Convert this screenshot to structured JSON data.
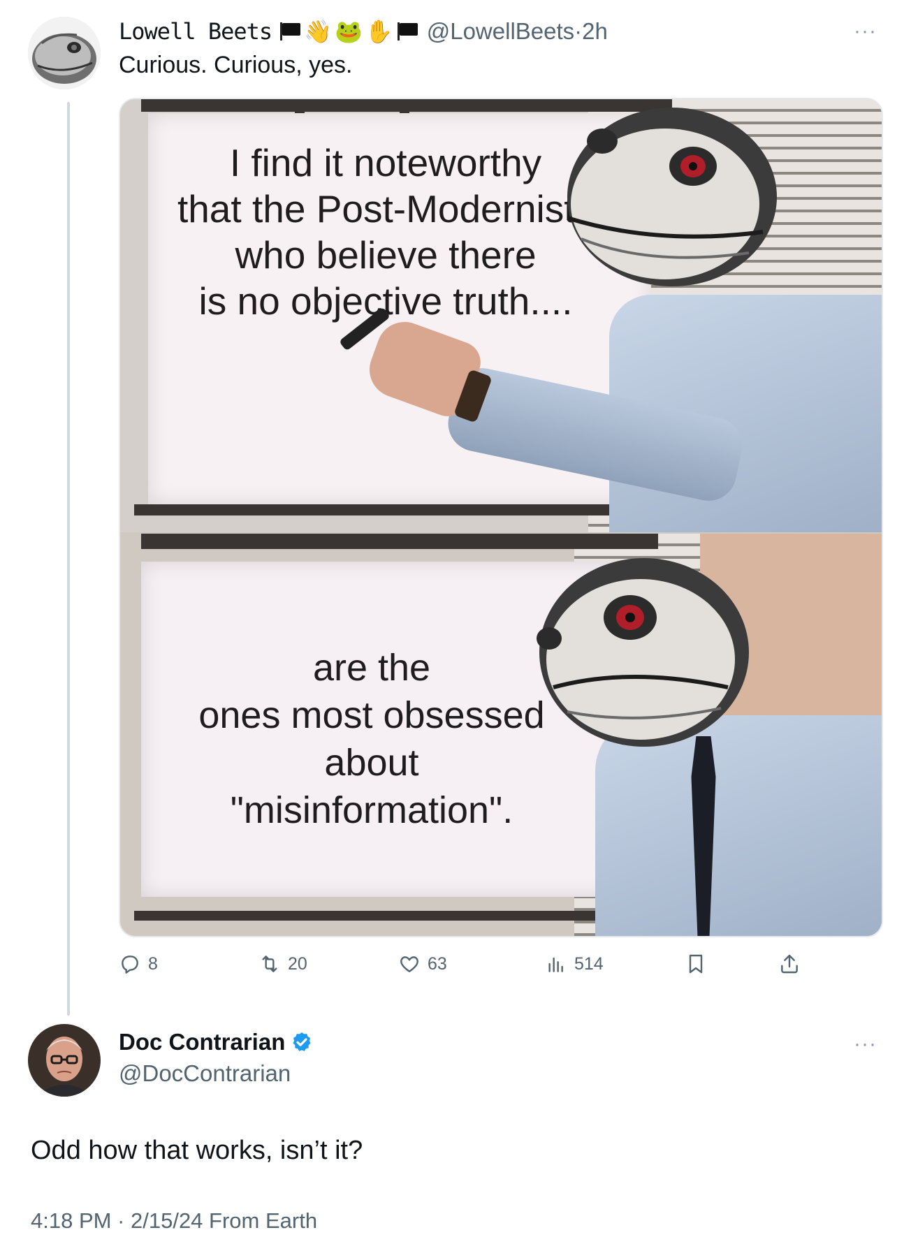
{
  "tweet": {
    "author_name": "Lowell Beets",
    "name_emojis": [
      "black-flag",
      "waving-hand",
      "frog",
      "raised-hand",
      "black-flag"
    ],
    "handle": "@LowellBeets",
    "separator": "·",
    "time_ago": "2h",
    "text": "Curious. Curious, yes.",
    "more_label": "···",
    "media": {
      "top_panel_text": [
        "I find it noteworthy",
        "that the Post-Modernists",
        "who believe there",
        "is no objective truth...."
      ],
      "bottom_panel_text": [
        "are the",
        "ones most obsessed",
        "about",
        "\"misinformation\"."
      ]
    },
    "actions": {
      "replies": "8",
      "reposts": "20",
      "likes": "63",
      "views": "514"
    }
  },
  "reply": {
    "author_name": "Doc Contrarian",
    "handle": "@DocContrarian",
    "verified": true,
    "more_label": "···",
    "text": "Odd how that works, isn’t it?",
    "meta": "4:18 PM · 2/15/24 From Earth"
  },
  "icons": {
    "reply": "speech-bubble-icon",
    "repost": "repost-arrows-icon",
    "like": "heart-icon",
    "views": "bar-chart-icon",
    "bookmark": "bookmark-icon",
    "share": "share-upload-icon",
    "verified": "verified-badge-icon"
  },
  "colors": {
    "text_primary": "#0f1419",
    "text_secondary": "#536471",
    "verified_blue": "#1d9bf0",
    "thread_line": "#cfd9de"
  }
}
